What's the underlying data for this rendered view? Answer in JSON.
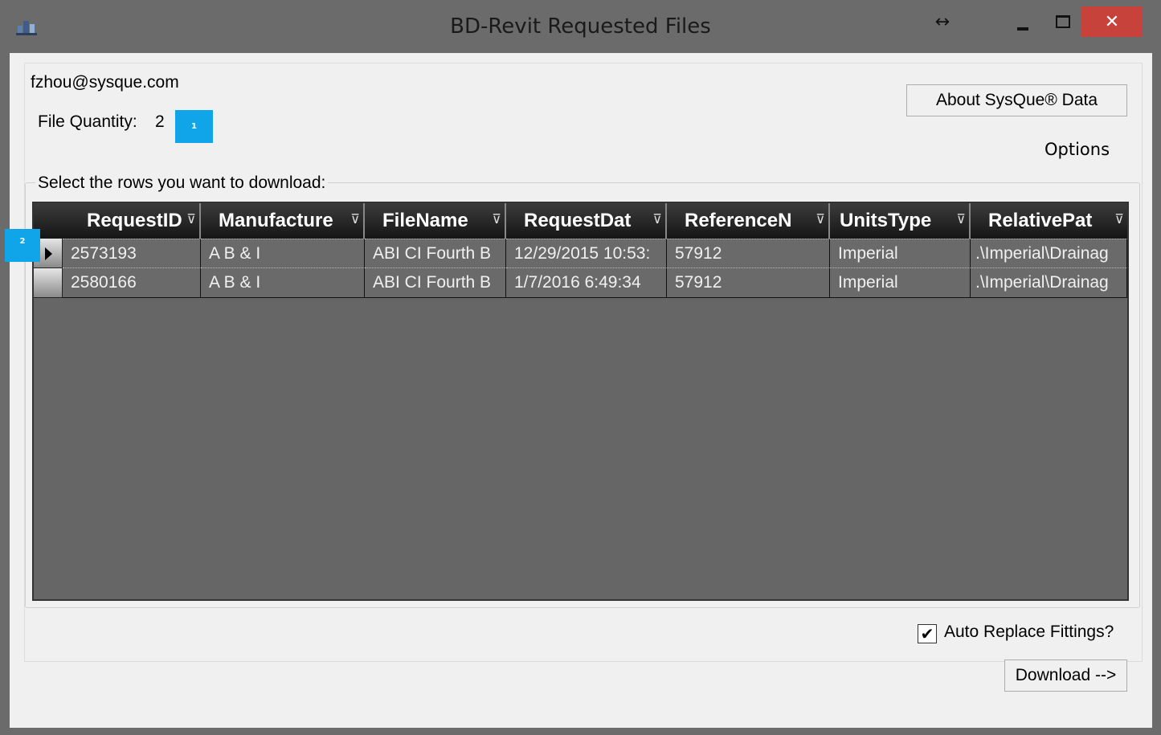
{
  "window": {
    "title": "BD-Revit Requested Files",
    "resize_glyph": "↔",
    "close_glyph": "✕",
    "icons": [
      "app-icon",
      "resize-icon",
      "minimize-icon",
      "maximize-icon",
      "close-icon"
    ]
  },
  "account": {
    "email": "fzhou@sysque.com"
  },
  "file_quantity": {
    "label": "File Quantity:",
    "value": "2"
  },
  "badges": [
    "1",
    "2"
  ],
  "buttons": {
    "about": "About SysQue® Data",
    "options": "Options",
    "download": "Download -->"
  },
  "grid": {
    "group_label": "Select the rows you want to download:",
    "columns": [
      "RequestID",
      "Manufacture",
      "FileName",
      "RequestDat",
      "ReferenceN",
      "UnitsType",
      "RelativePat"
    ],
    "filter_glyph": "⊽",
    "rows": [
      [
        "2573193",
        "A B & I",
        "ABI CI Fourth B",
        "12/29/2015 10:53:",
        "57912",
        "Imperial",
        ".\\Imperial\\Drainag"
      ],
      [
        "2580166",
        "A B & I",
        "ABI CI Fourth B",
        "1/7/2016 6:49:34",
        "57912",
        "Imperial",
        ".\\Imperial\\Drainag"
      ]
    ],
    "selected_row": 0
  },
  "auto_replace": {
    "label": "Auto Replace Fittings?",
    "checked": true,
    "check_glyph": "✔"
  },
  "colors": {
    "badge": "#10a4e8",
    "close_button": "#c7423a",
    "grid_background": "#666666"
  }
}
